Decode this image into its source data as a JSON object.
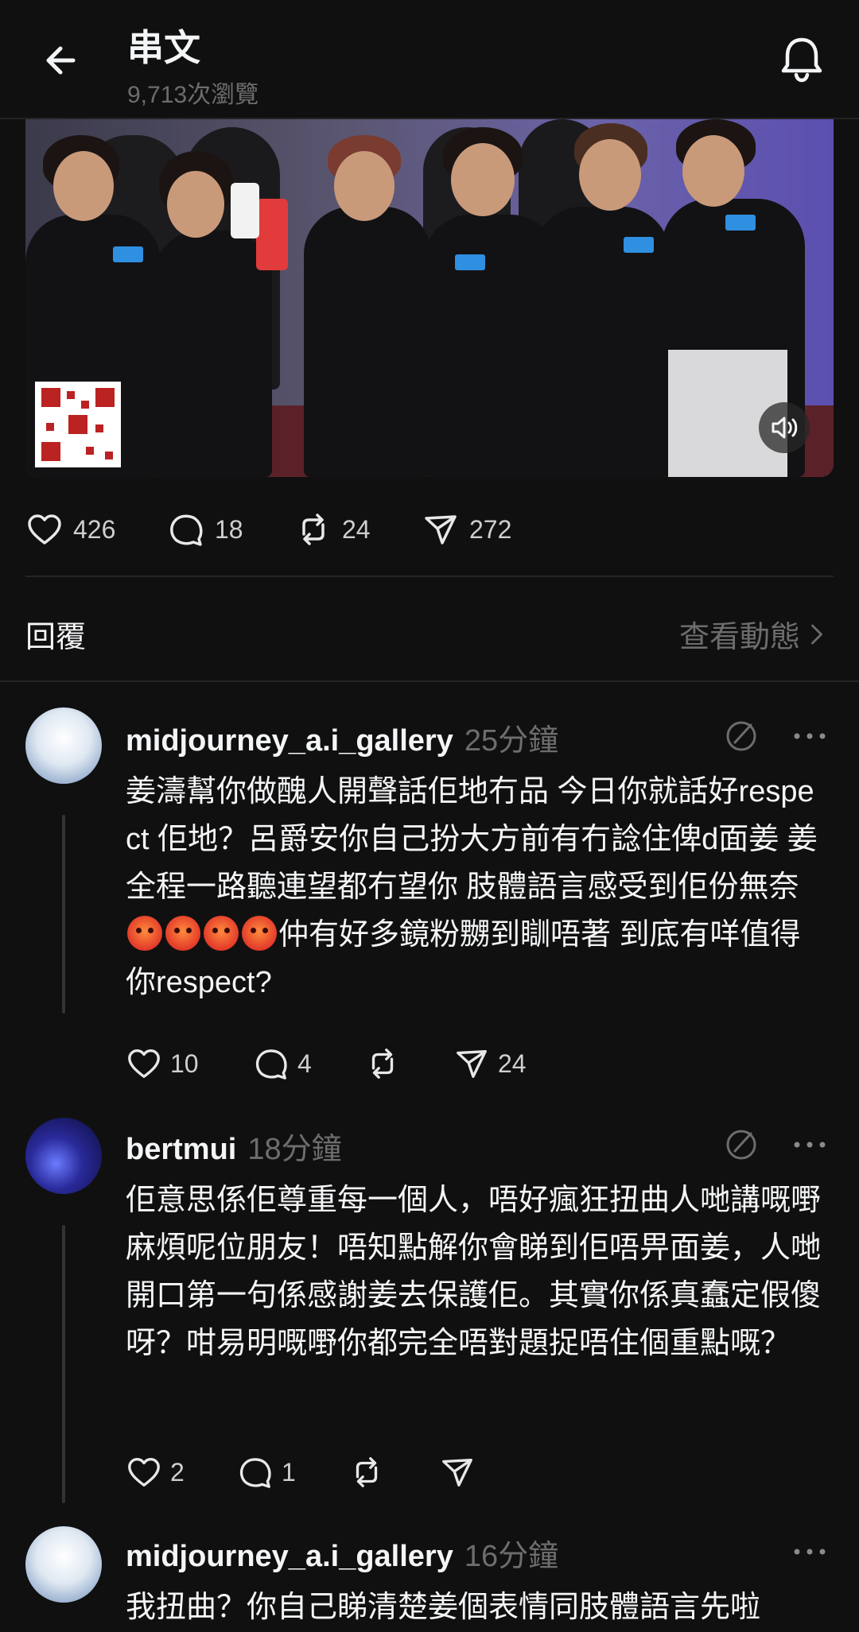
{
  "header": {
    "title": "串文",
    "views": "9,713次瀏覽"
  },
  "post": {
    "likes": "426",
    "comments": "18",
    "reposts": "24",
    "shares": "272"
  },
  "replies": {
    "title": "回覆",
    "activity_link": "查看動態"
  },
  "comments": [
    {
      "username": "midjourney_a.i_gallery",
      "time": "25分鐘",
      "text_a": "姜濤幫你做醜人開聲話佢地冇品 今日你就話好respect 佢地？呂爵安你自己扮大方前有冇諗住俾d面姜 姜全程一路聽連望都冇望你 肢體語言感受到佢份無奈",
      "text_b": "仲有好多鏡粉嬲到瞓唔著 到底有咩值得你respect?",
      "likes": "10",
      "comments": "4"
    },
    {
      "username": "bertmui",
      "time": "18分鐘",
      "text": "佢意思係佢尊重每一個人，唔好瘋狂扭曲人哋講嘅嘢麻煩呢位朋友！唔知點解你會睇到佢唔畀面姜，人哋開口第一句係感謝姜去保護佢。其實你係真蠢定假傻呀？咁易明嘅嘢你都完全唔對題捉唔住個重點嘅？",
      "likes": "2",
      "comments": "1"
    },
    {
      "username": "midjourney_a.i_gallery",
      "time": "16分鐘",
      "text": "我扭曲？你自己睇清楚姜個表情同肢體語言先啦"
    }
  ],
  "colors": {
    "background": "#101010",
    "text": "#f3f5f7",
    "muted": "#6d6d6d",
    "divider": "#262626"
  },
  "icons": [
    "back-arrow-icon",
    "bell-icon",
    "heart-icon",
    "comment-icon",
    "repost-icon",
    "share-icon",
    "chevron-right-icon",
    "translate-icon",
    "more-icon",
    "volume-icon"
  ]
}
